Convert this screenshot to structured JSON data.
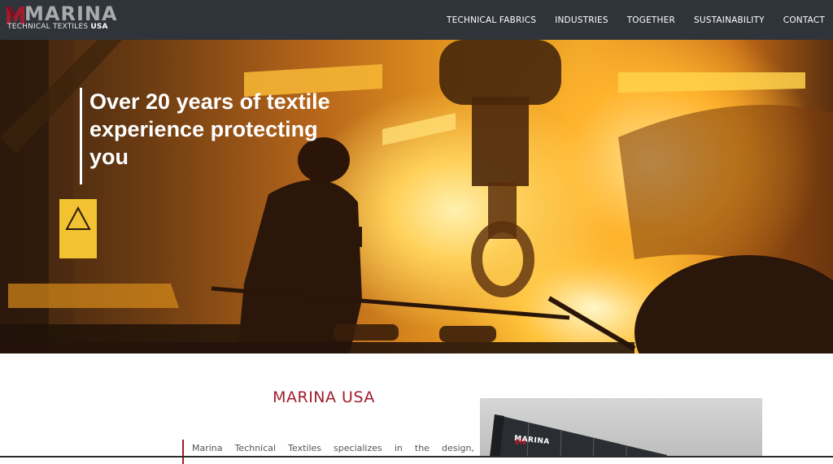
{
  "header": {
    "logo_word": "MARINA",
    "logo_sub_light": "TECHNICAL TEXTILES ",
    "logo_sub_bold": "USA",
    "nav": [
      {
        "label": "TECHNICAL FABRICS"
      },
      {
        "label": "INDUSTRIES"
      },
      {
        "label": "TOGETHER"
      },
      {
        "label": "SUSTAINABILITY"
      },
      {
        "label": "CONTACT"
      }
    ]
  },
  "hero": {
    "title": "Over 20 years of textile experience protecting you"
  },
  "about": {
    "title": "MARINA USA",
    "intro": "Marina Technical Textiles specializes in the design,",
    "building_sign": "MARINA"
  },
  "colors": {
    "header_bg": "#2f343a",
    "brand_red": "#a01c2c",
    "logo_grey": "#a9aaac"
  }
}
